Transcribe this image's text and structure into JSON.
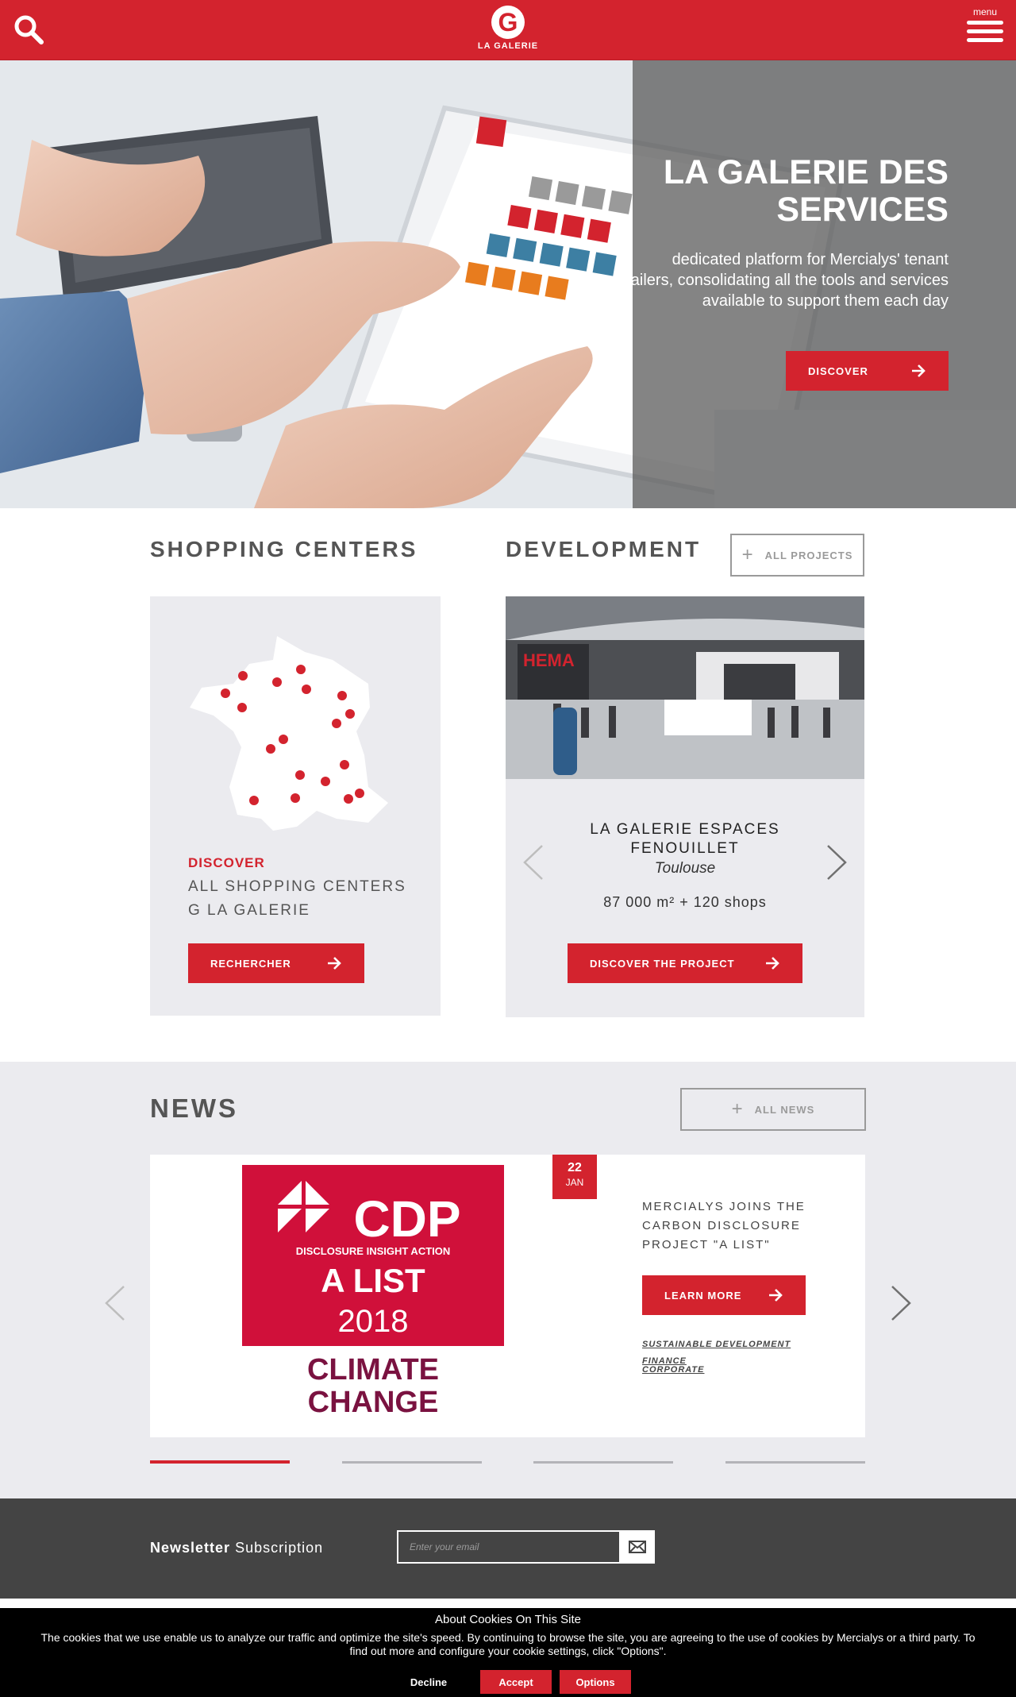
{
  "header": {
    "menu_label": "menu",
    "logo_text": "LA GALERIE",
    "logo_letter": "G"
  },
  "hero": {
    "title": "LA GALERIE DES SERVICES",
    "description": "dedicated platform for Mercialys' tenant retailers, consolidating all the tools and services available to support them each day",
    "button_label": "DISCOVER"
  },
  "shopping_centers": {
    "title": "SHOPPING CENTERS",
    "discover_label": "DISCOVER",
    "line1": "ALL SHOPPING CENTERS",
    "line2": "G LA GALERIE",
    "button_label": "RECHERCHER"
  },
  "development": {
    "title": "DEVELOPMENT",
    "all_projects_label": "ALL PROJECTS",
    "photo_sign_text": "HEMA",
    "project_name": "LA GALERIE ESPACES FENOUILLET",
    "project_city": "Toulouse",
    "project_stats": "87 000 m² + 120 shops",
    "button_label": "DISCOVER THE PROJECT"
  },
  "news": {
    "title": "NEWS",
    "all_news_label": "ALL NEWS",
    "date_day": "22",
    "date_month": "JAN",
    "article_title": "MERCIALYS JOINS THE CARBON DISCLOSURE PROJECT \"A LIST\"",
    "button_label": "LEARN MORE",
    "tags": [
      "SUSTAINABLE DEVELOPMENT",
      "FINANCE",
      "CORPORATE"
    ],
    "image": {
      "logo_text": "CDP",
      "tagline": "DISCLOSURE INSIGHT ACTION",
      "list_text": "A LIST",
      "year": "2018",
      "topic_line1": "CLIMATE",
      "topic_line2": "CHANGE"
    },
    "pager_count": 4,
    "pager_active": 1
  },
  "newsletter": {
    "label_bold": "Newsletter",
    "label_rest": "Subscription",
    "placeholder": "Enter your email"
  },
  "cookie": {
    "title": "About Cookies On This Site",
    "text": "The cookies that we use enable us to analyze our traffic and optimize the site's speed. By continuing to browse the site, you are agreeing to the use of cookies by Mercialys or a third party. To find out more and configure your cookie settings, click \"Options\".",
    "decline_label": "Decline",
    "accept_label": "Accept",
    "options_label": "Options"
  },
  "colors": {
    "brand_red": "#d3232e",
    "card_grey": "#ebebef",
    "footer_dark": "#444444",
    "cdp_red": "#d0103a",
    "cdp_purple": "#7a1240"
  }
}
